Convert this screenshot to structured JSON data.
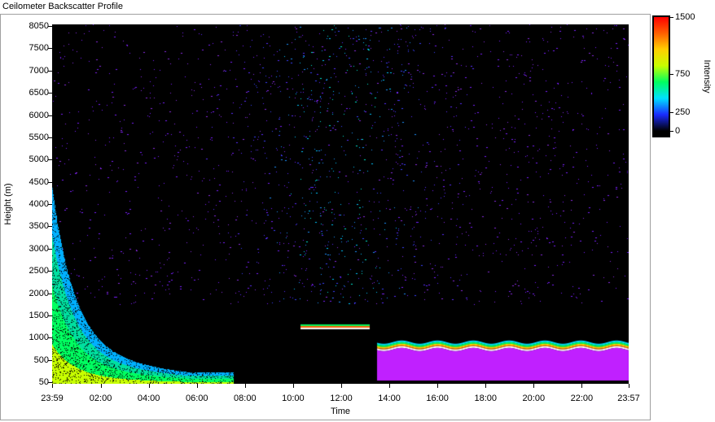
{
  "window": {
    "title": "Ceilometer Backscatter Profile"
  },
  "chart_data": {
    "type": "heatmap",
    "title": "Ceilometer Backscatter Profile",
    "xlabel": "Time",
    "ylabel": "Height (m)",
    "x_ticks": [
      "23:59",
      "02:00",
      "04:00",
      "06:00",
      "08:00",
      "10:00",
      "12:00",
      "14:00",
      "16:00",
      "18:00",
      "20:00",
      "22:00",
      "23:57"
    ],
    "y_ticks": [
      8050,
      7500,
      7000,
      6500,
      6000,
      5500,
      5000,
      4500,
      4000,
      3500,
      3000,
      2500,
      2000,
      1500,
      1000,
      500,
      50
    ],
    "ylim": [
      50,
      8050
    ],
    "grid": false,
    "colorscale": {
      "title": "Intensity",
      "ticks": [
        1500,
        750,
        250,
        0
      ],
      "tick_labels": [
        "1500",
        "750",
        "250",
        "0"
      ],
      "range": [
        0,
        1500
      ],
      "colors": [
        "#000000",
        "#1a2bff",
        "#00e0ff",
        "#00ff60",
        "#c8ff00",
        "#ffd000",
        "#ff6000",
        "#ff0000"
      ]
    },
    "features": [
      {
        "name": "aerosol layer",
        "time_range": [
          "23:59",
          "07:30"
        ],
        "top_height_m": [
          3500,
          300
        ]
      },
      {
        "name": "boundary layer top",
        "time_range": [
          "13:30",
          "23:57"
        ],
        "height_m": 850
      },
      {
        "name": "elevated layer",
        "time_range": [
          "10:20",
          "13:10"
        ],
        "height_m": 1300
      },
      {
        "name": "upper scatter",
        "time_range": [
          "08:30",
          "16:00"
        ],
        "height_range_m": [
          2000,
          8050
        ]
      }
    ]
  }
}
